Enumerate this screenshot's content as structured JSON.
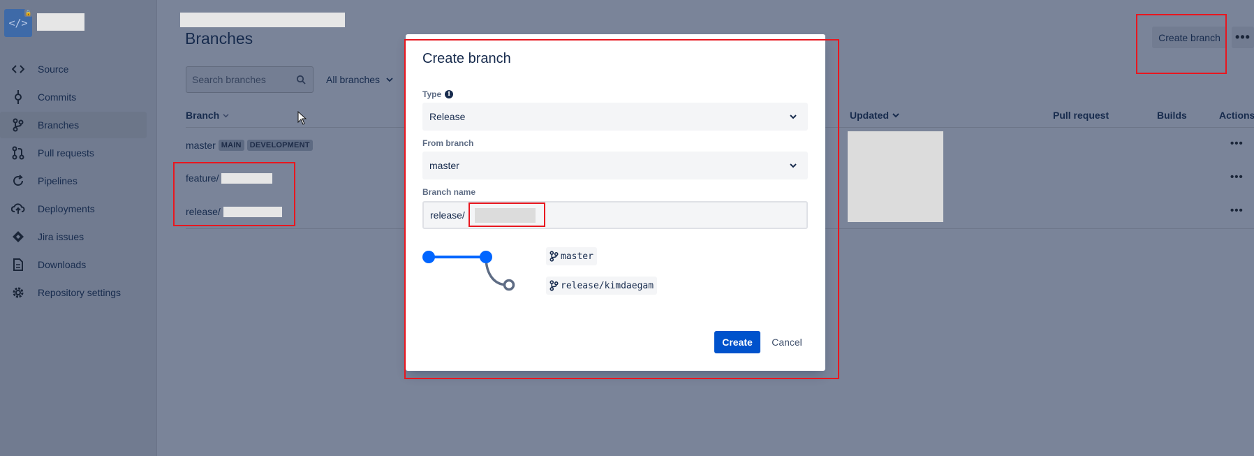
{
  "sidebar": {
    "repo_avatar_glyph": "</>",
    "items": [
      {
        "label": "Source",
        "icon": "code-icon"
      },
      {
        "label": "Commits",
        "icon": "commit-icon"
      },
      {
        "label": "Branches",
        "icon": "branch-icon",
        "active": true
      },
      {
        "label": "Pull requests",
        "icon": "pull-request-icon"
      },
      {
        "label": "Pipelines",
        "icon": "pipelines-icon"
      },
      {
        "label": "Deployments",
        "icon": "cloud-upload-icon"
      },
      {
        "label": "Jira issues",
        "icon": "jira-icon"
      },
      {
        "label": "Downloads",
        "icon": "document-icon"
      },
      {
        "label": "Repository settings",
        "icon": "gear-icon"
      }
    ]
  },
  "header": {
    "title": "Branches",
    "create_branch_label": "Create branch",
    "more_label": "•••"
  },
  "filters": {
    "search_placeholder": "Search branches",
    "branch_filter": "All branches"
  },
  "table": {
    "columns": {
      "branch": "Branch",
      "updated": "Updated",
      "pull_request": "Pull request",
      "builds": "Builds",
      "actions": "Actions"
    },
    "rows": [
      {
        "prefix": "master",
        "lozenges": [
          "MAIN",
          "DEVELOPMENT"
        ]
      },
      {
        "prefix": "feature/"
      },
      {
        "prefix": "release/"
      }
    ],
    "row_action_label": "•••"
  },
  "modal": {
    "title": "Create branch",
    "type_label": "Type",
    "type_value": "Release",
    "from_branch_label": "From branch",
    "from_branch_value": "master",
    "branch_name_label": "Branch name",
    "branch_name_prefix": "release/",
    "diagram": {
      "source_branch": "master",
      "new_branch": "release/kimdaegam"
    },
    "create_label": "Create",
    "cancel_label": "Cancel"
  },
  "colors": {
    "overlay": "#7a8499",
    "primary": "#0052cc",
    "annotation": "#e8171f",
    "redaction": "#e6e6e6"
  }
}
